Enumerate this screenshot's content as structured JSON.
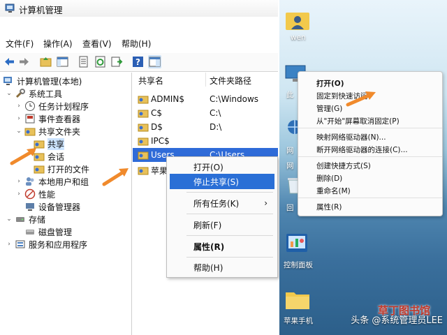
{
  "window": {
    "title": "计算机管理"
  },
  "menu": [
    "文件(F)",
    "操作(A)",
    "查看(V)",
    "帮助(H)"
  ],
  "tree": {
    "root": "计算机管理(本地)",
    "system_tools": "系统工具",
    "task_scheduler": "任务计划程序",
    "event_viewer": "事件查看器",
    "shared_folders": "共享文件夹",
    "shares": "共享",
    "sessions": "会话",
    "open_files": "打开的文件",
    "local_users": "本地用户和组",
    "performance": "性能",
    "device_manager": "设备管理器",
    "storage": "存储",
    "disk_management": "磁盘管理",
    "services": "服务和应用程序"
  },
  "list": {
    "col_share": "共享名",
    "col_path": "文件夹路径",
    "rows": [
      {
        "name": "ADMIN$",
        "path": "C:\\Windows"
      },
      {
        "name": "C$",
        "path": "C:\\"
      },
      {
        "name": "D$",
        "path": "D:\\"
      },
      {
        "name": "IPC$",
        "path": ""
      },
      {
        "name": "Users",
        "path": "C:\\Users"
      },
      {
        "name": "苹果",
        "path": ""
      }
    ]
  },
  "context_menu": {
    "open": "打开(O)",
    "stop_share": "停止共享(S)",
    "all_tasks": "所有任务(K)",
    "refresh": "刷新(F)",
    "properties": "属性(R)",
    "help": "帮助(H)"
  },
  "desktop": {
    "icons": [
      {
        "label": "wen"
      },
      {
        "label": "此"
      },
      {
        "label": "网"
      },
      {
        "label": "网"
      },
      {
        "label": "回"
      },
      {
        "label": "控制面板"
      },
      {
        "label": "苹果手机"
      }
    ],
    "menu": [
      "打开(O)",
      "固定到快速访问",
      "管理(G)",
      "从\"开始\"屏幕取消固定(P)",
      "映射网络驱动器(N)...",
      "断开网络驱动器的连接(C)...",
      "创建快捷方式(S)",
      "删除(D)",
      "重命名(M)",
      "属性(R)"
    ]
  },
  "watermark": {
    "text": "头条 @系统管理员LEE",
    "stamp": "草丁图书馆"
  },
  "colors": {
    "selection": "#2f6bd8",
    "arrow": "#f08a2c",
    "folder": "#e8c15a"
  }
}
